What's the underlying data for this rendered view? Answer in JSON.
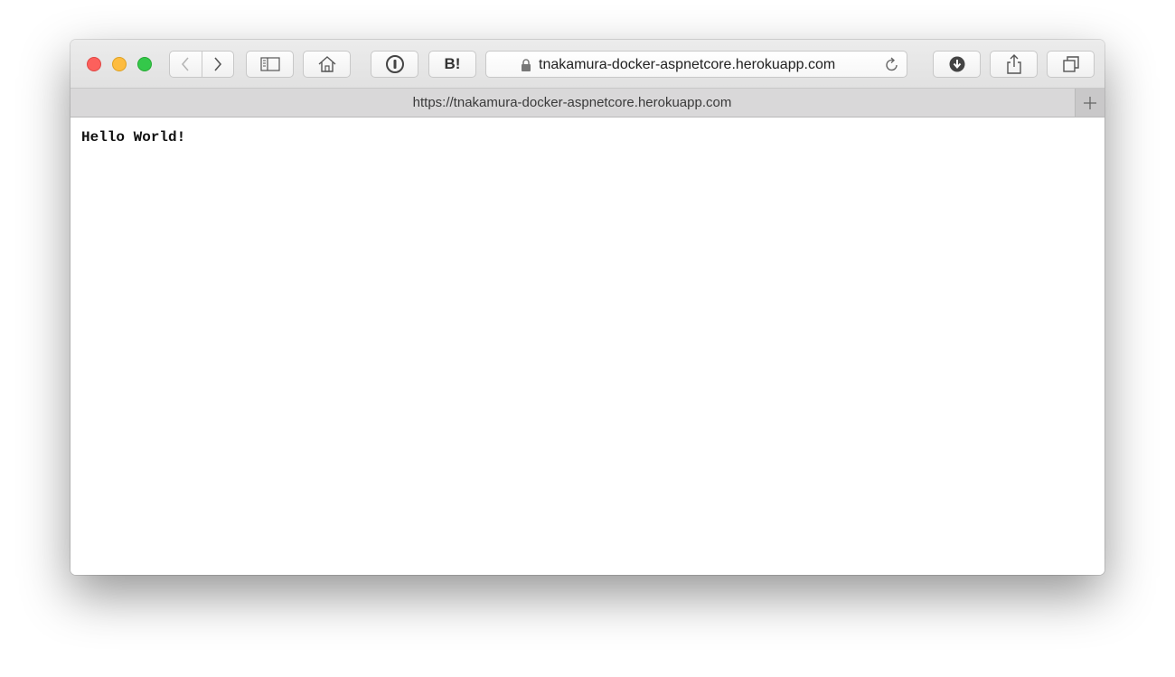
{
  "browser": {
    "address_host": "tnakamura-docker-aspnetcore.herokuapp.com",
    "bookmark_label": "B!",
    "tab_title": "https://tnakamura-docker-aspnetcore.herokuapp.com",
    "new_tab_label": "+"
  },
  "icons": {
    "close": "close-icon",
    "minimize": "minimize-icon",
    "maximize": "maximize-icon",
    "back": "chevron-left-icon",
    "forward": "chevron-right-icon",
    "sidebar": "sidebar-icon",
    "home": "home-icon",
    "password": "password-manager-icon",
    "lock": "lock-icon",
    "reload": "reload-icon",
    "downloads": "download-icon",
    "share": "share-icon",
    "tabs": "tab-overview-icon"
  },
  "page": {
    "body_text": "Hello World!"
  },
  "colors": {
    "close": "#fc605c",
    "minimize": "#fdbc40",
    "maximize": "#34c84a",
    "toolbar": "#e6e6e6",
    "tabbar": "#d9d8d9"
  }
}
